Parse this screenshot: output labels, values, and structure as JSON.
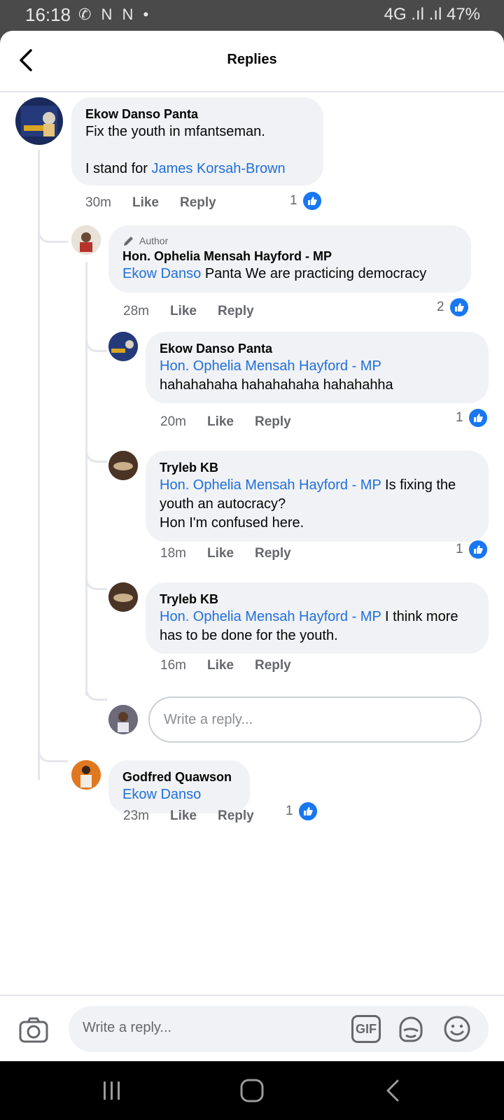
{
  "status_bar": {
    "time": "16:18",
    "left_icons": "✆ N N •",
    "right_text": "4G .ıl .ıl 47%"
  },
  "header": {
    "title": "Replies"
  },
  "comments": [
    {
      "name": "Ekow Danso Panta",
      "line1": "Fix the youth in mfantseman.",
      "line2_prefix": "I stand for ",
      "mention": "James Korsah-Brown",
      "time": "30m",
      "like": "Like",
      "reply": "Reply",
      "likes": "1"
    },
    {
      "author_tag": "Author",
      "name": "Hon. Ophelia Mensah Hayford - MP",
      "mention": "Ekow Danso",
      "text": " Panta We are practicing democracy",
      "time": "28m",
      "like": "Like",
      "reply": "Reply",
      "likes": "2"
    },
    {
      "name": "Ekow Danso Panta",
      "mention": "Hon. Ophelia Mensah Hayford - MP",
      "text": "hahahahaha hahahahaha hahahahha",
      "time": "20m",
      "like": "Like",
      "reply": "Reply",
      "likes": "1"
    },
    {
      "name": "Tryleb KB",
      "mention": "Hon. Ophelia Mensah Hayford - MP",
      "text": " Is fixing the youth an autocracy?",
      "text2": "Hon I'm confused here.",
      "time": "18m",
      "like": "Like",
      "reply": "Reply",
      "likes": "1"
    },
    {
      "name": "Tryleb KB",
      "mention": "Hon. Ophelia Mensah Hayford - MP",
      "text": " I think more has to be done for the youth.",
      "time": "16m",
      "like": "Like",
      "reply": "Reply"
    },
    {
      "name": "Godfred Quawson",
      "mention": "Ekow Danso",
      "time": "23m",
      "like": "Like",
      "reply": "Reply",
      "likes": "1"
    }
  ],
  "nested_reply_placeholder": "Write a reply...",
  "composer": {
    "placeholder": "Write a reply...",
    "gif_label": "GIF"
  },
  "colors": {
    "mention": "#216fdb",
    "like_blue": "#1877f2",
    "bubble": "#f0f2f5"
  }
}
